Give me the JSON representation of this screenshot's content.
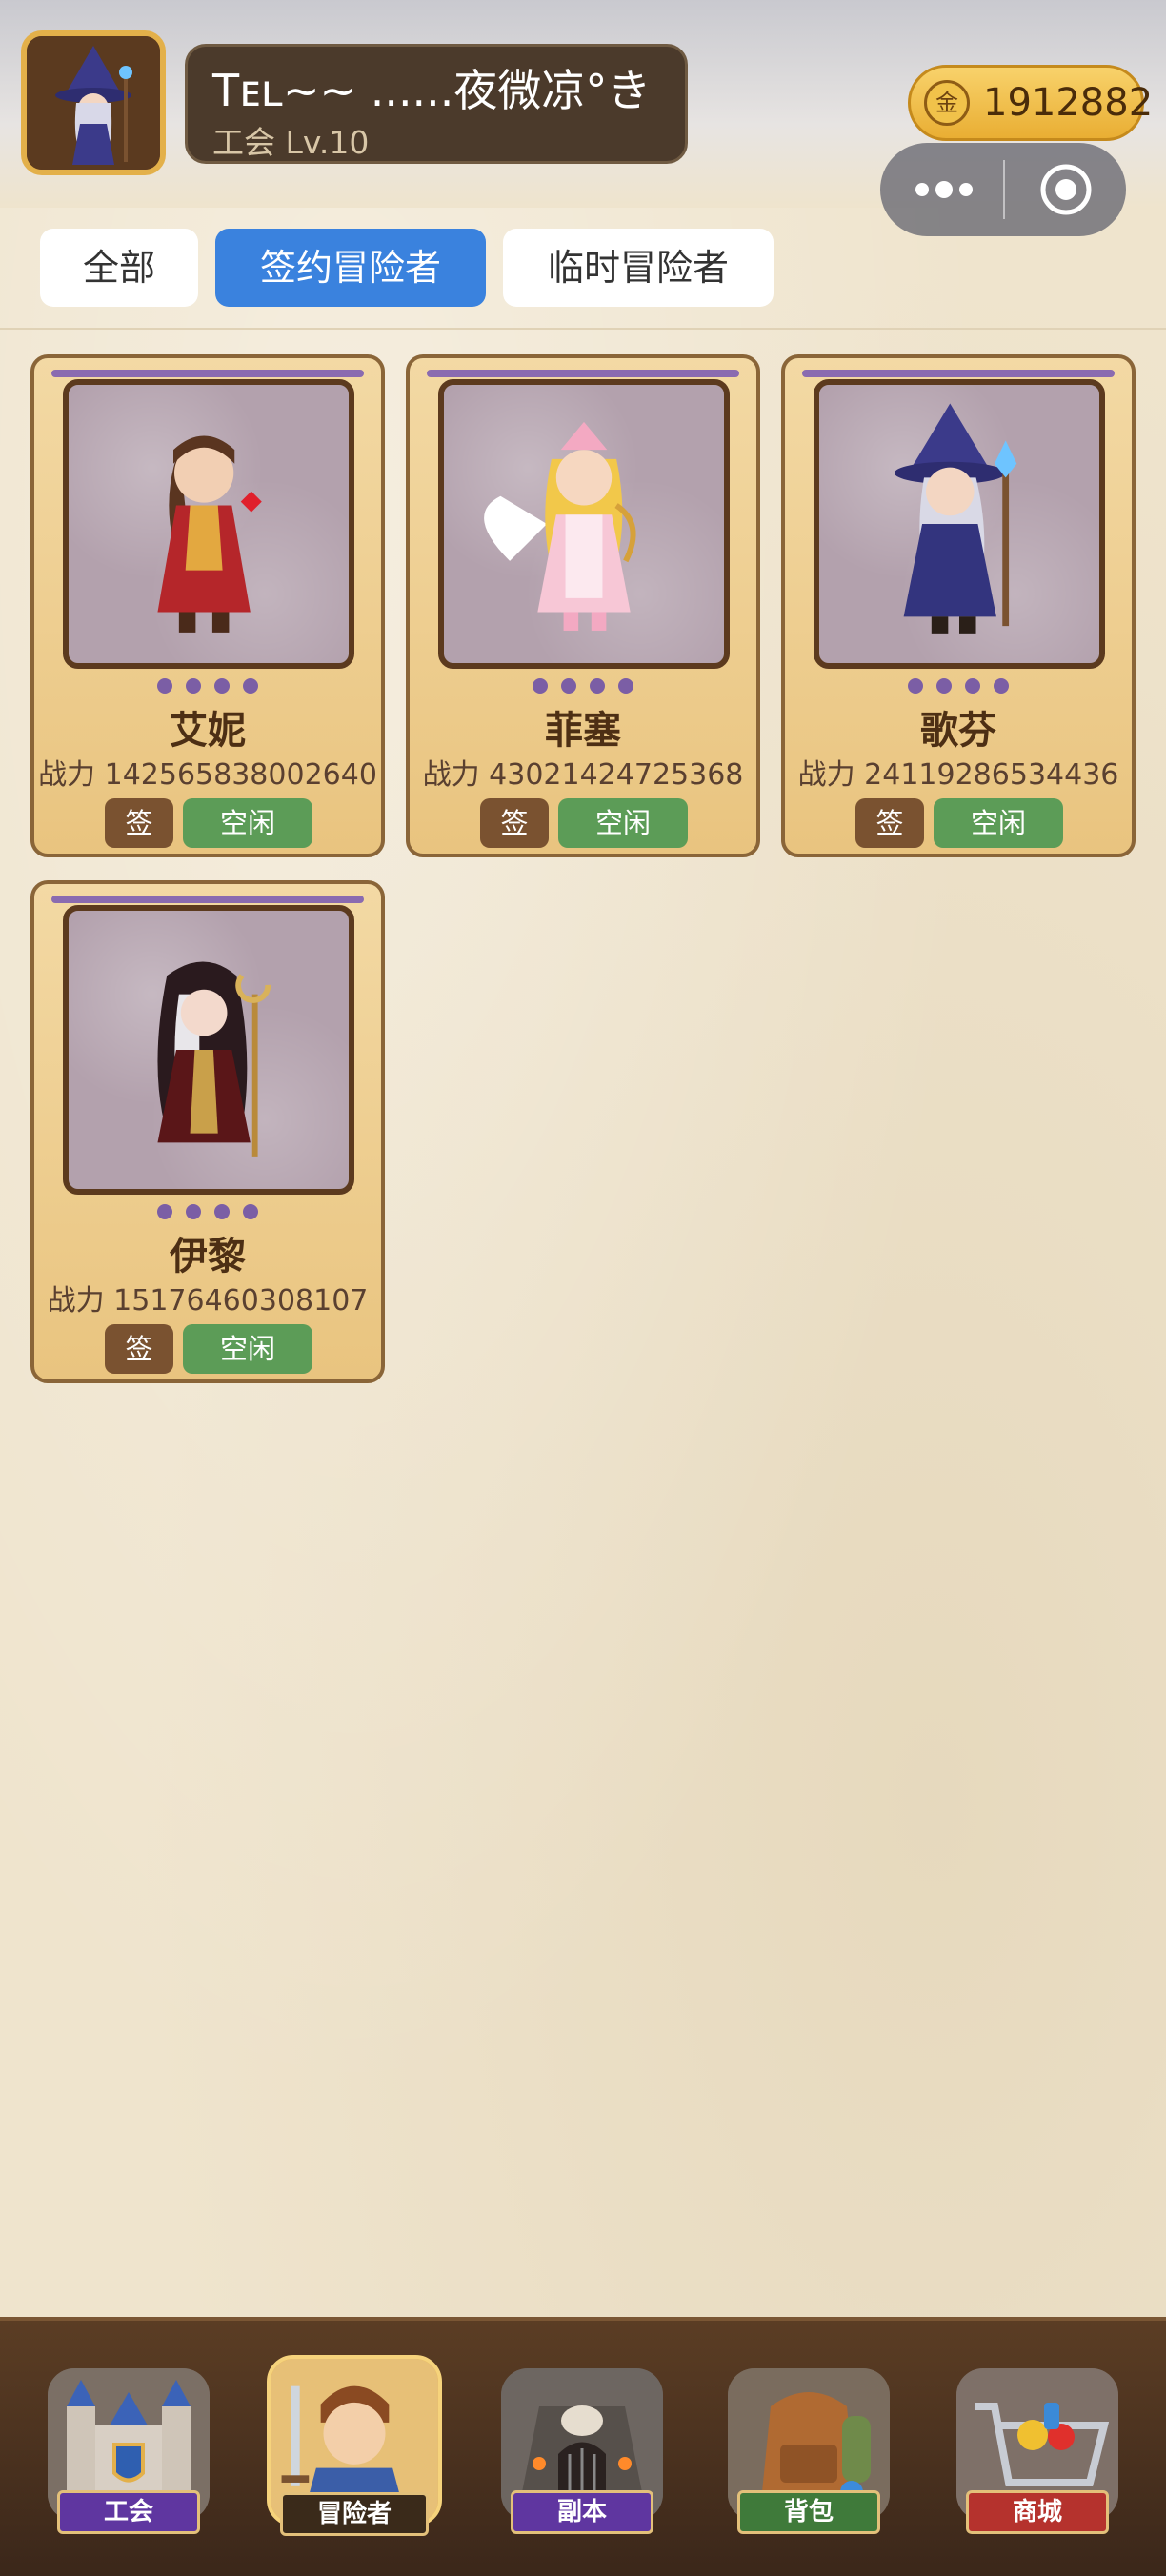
{
  "header": {
    "player_name": "Tᴇʟ~~ ......夜微凉°き",
    "guild_level": "工会 Lv.10",
    "coin_icon_label": "金",
    "coins": "1912882"
  },
  "tabs": [
    {
      "label": "全部",
      "active": false
    },
    {
      "label": "签约冒险者",
      "active": true
    },
    {
      "label": "临时冒险者",
      "active": false
    }
  ],
  "adventurers": [
    {
      "name": "艾妮",
      "power_label": "战力",
      "power": "142565838002640",
      "sign_label": "签",
      "status": "空闲",
      "stars": 4
    },
    {
      "name": "菲塞",
      "power_label": "战力",
      "power": "43021424725368",
      "sign_label": "签",
      "status": "空闲",
      "stars": 4
    },
    {
      "name": "歌芬",
      "power_label": "战力",
      "power": "24119286534436",
      "sign_label": "签",
      "status": "空闲",
      "stars": 4
    },
    {
      "name": "伊黎",
      "power_label": "战力",
      "power": "15176460308107",
      "sign_label": "签",
      "status": "空闲",
      "stars": 4
    }
  ],
  "nav": [
    {
      "label": "工会",
      "icon": "castle-icon"
    },
    {
      "label": "冒险者",
      "icon": "hero-icon",
      "active": true
    },
    {
      "label": "副本",
      "icon": "dungeon-icon"
    },
    {
      "label": "背包",
      "icon": "backpack-icon"
    },
    {
      "label": "商城",
      "icon": "shop-cart-icon"
    }
  ],
  "colors": {
    "active_tab": "#3a82de",
    "idle_badge": "#5c9c57",
    "sign_badge": "#7a5230",
    "card_bg": "#ecca88",
    "coin_gold": "#f0bf4a"
  }
}
